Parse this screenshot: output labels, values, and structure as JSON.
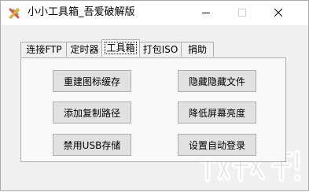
{
  "window": {
    "title": "小小工具箱_吾爱破解版"
  },
  "titlebar": {
    "minimize_icon": "minimize-icon",
    "maximize_icon": "maximize-icon",
    "close_icon": "close-icon"
  },
  "tabs": [
    {
      "label": "连接FTP"
    },
    {
      "label": "定时器"
    },
    {
      "label": "工具箱"
    },
    {
      "label": "打包ISO"
    },
    {
      "label": "捐助"
    }
  ],
  "active_tab": "工具箱",
  "buttons": {
    "rebuild_icon_cache": "重建图标缓存",
    "hide_hidden_files": "隐藏隐藏文件",
    "add_copy_path": "添加复制路径",
    "lower_screen_brightness": "降低屏幕亮度",
    "disable_usb_storage": "禁用USB存储",
    "set_auto_login": "设置自动登录"
  },
  "colors": {
    "accent": "#e81123",
    "tab_border": "#adadad",
    "button_face": "#e1e1e1"
  }
}
